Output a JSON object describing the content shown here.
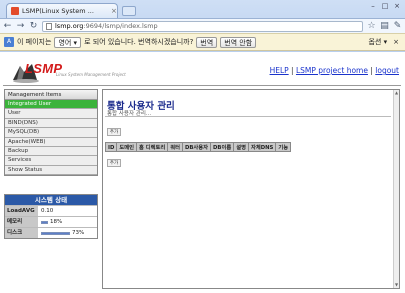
{
  "browser": {
    "tab_title": "LSMP(Linux System ...",
    "url_host": "lsmp.org",
    "url_rest": ":9694/lsmp/index.lsmp",
    "close_glyph": "×"
  },
  "translate_bar": {
    "prefix": "이 페이지는",
    "language": "영어",
    "middle": "로 되어 있습니다. 번역하시겠습니까?",
    "translate_button": "번역",
    "no_translate_button": "번역 안함",
    "options": "옵션"
  },
  "header": {
    "logo_text": "LSMP",
    "logo_subtitle": "Linux System Management Project",
    "links": [
      "HELP",
      "LSMP project home",
      "logout"
    ]
  },
  "sidebar": {
    "menu_title": "Management Items",
    "items": [
      {
        "label": "Integrated User",
        "active": true
      },
      {
        "label": "User"
      },
      {
        "label": "BIND(DNS)"
      },
      {
        "label": "MySQL(DB)"
      },
      {
        "label": "Apache(WEB)"
      },
      {
        "label": "Backup"
      },
      {
        "label": "Services"
      },
      {
        "label": "Show Status"
      }
    ]
  },
  "system_status": {
    "title": "시스템 상태",
    "rows": [
      {
        "label": "LoadAVG",
        "value": "0.10"
      },
      {
        "label": "메모리",
        "value": "18%",
        "fraction": 0.18
      },
      {
        "label": "디스크",
        "value": "73%",
        "fraction": 0.73
      }
    ]
  },
  "content": {
    "title": "통합 사용자 관리",
    "subtitle": "통합 사용자 관리...",
    "add_button": "추가",
    "table_columns": [
      "ID",
      "도메인",
      "홈 디렉토리",
      "쿼터",
      "DB사용자",
      "DB이름",
      "설명",
      "자체DNS",
      "기능"
    ]
  },
  "colors": {
    "active_menu": "#3bb33b",
    "status_header": "#2b59a7",
    "logo": "#d31a1a",
    "link": "#1a33cc"
  }
}
